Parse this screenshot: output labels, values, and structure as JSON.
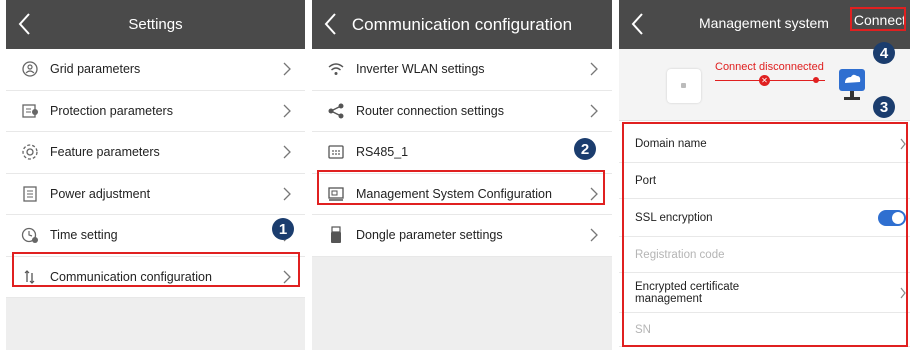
{
  "panels": {
    "settings": {
      "title": "Settings",
      "items": [
        {
          "label": "Grid parameters",
          "icon": "grid-parameters-icon"
        },
        {
          "label": "Protection parameters",
          "icon": "protection-icon"
        },
        {
          "label": "Feature parameters",
          "icon": "feature-icon"
        },
        {
          "label": "Power adjustment",
          "icon": "power-adjust-icon"
        },
        {
          "label": "Time setting",
          "icon": "clock-icon"
        },
        {
          "label": "Communication configuration",
          "icon": "communication-icon"
        }
      ],
      "step_badge": "1"
    },
    "communication": {
      "title": "Communication configuration",
      "items": [
        {
          "label": "Inverter WLAN settings",
          "icon": "wifi-icon"
        },
        {
          "label": "Router connection settings",
          "icon": "share-icon"
        },
        {
          "label": "RS485_1",
          "icon": "rs485-icon"
        },
        {
          "label": "Management System Configuration",
          "icon": "management-icon"
        },
        {
          "label": "Dongle parameter settings",
          "icon": "dongle-icon"
        }
      ],
      "step_badge": "2"
    },
    "management": {
      "title": "Management system",
      "connect_label": "Connect",
      "status_text": "Connect disconnected",
      "items": [
        {
          "label": "Domain name"
        },
        {
          "label": "Port"
        },
        {
          "label": "SSL encryption"
        },
        {
          "label": "Registration code"
        },
        {
          "label": "Encrypted certificate management"
        },
        {
          "label": "SN"
        }
      ],
      "ssl_enabled": true,
      "step_badge_3": "3",
      "step_badge_4": "4"
    }
  },
  "colors": {
    "header": "#4a4a4a",
    "highlight": "#e02020",
    "badge": "#1b3d6e",
    "toggle_on": "#2f6fd0"
  }
}
